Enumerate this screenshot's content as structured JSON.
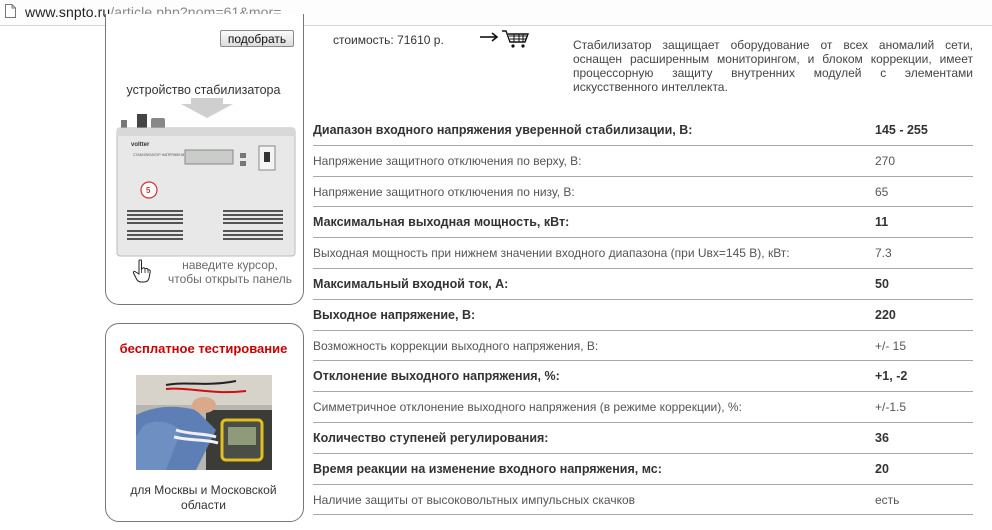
{
  "address_bar": {
    "domain": "www.snpto.ru",
    "path": "/article.php?nom=61&mor="
  },
  "left": {
    "pick_button": "подобрать",
    "device_label": "устройство стабилизатора",
    "device_brand": "voltter",
    "device_caption": "СТАБИЛИЗАТОР НАПРЯЖЕНИЯ",
    "hint_line1": "наведите курсор,",
    "hint_line2": "чтобы открыть панель",
    "free_testing": "бесплатное тестирование",
    "region_line1": "для Москвы и Московской",
    "region_line2": "области"
  },
  "product": {
    "cost": "стоимость: 71610 р.",
    "description": "Стабилизатор защищает оборудование от всех аномалий сети, оснащен расширенным мониторингом, и блоком коррекции, имеет процессорную защиту внутренних модулей с элементами искусственного интеллекта."
  },
  "specs": [
    {
      "label": "Диапазон входного напряжения уверенной стабилизации, В:",
      "value": "145 - 255",
      "bold": true
    },
    {
      "label": "Напряжение защитного отключения по верху, В:",
      "value": "270",
      "bold": false
    },
    {
      "label": "Напряжение защитного отключения по низу, В:",
      "value": "65",
      "bold": false
    },
    {
      "label": "Максимальная выходная мощность, кВт:",
      "value": "11",
      "bold": true
    },
    {
      "label": "Выходная мощность при нижнем значении входного диапазона (при Uвх=145 В), кВт:",
      "value": "7.3",
      "bold": false
    },
    {
      "label": "Максимальный входной ток, А:",
      "value": "50",
      "bold": true
    },
    {
      "label": "Выходное напряжение, В:",
      "value": "220",
      "bold": true
    },
    {
      "label": "Возможность коррекции выходного напряжения, В:",
      "value": "+/- 15",
      "bold": false
    },
    {
      "label": "Отклонение выходного напряжения, %:",
      "value": "+1, -2",
      "bold": true
    },
    {
      "label": "Симметричное отклонение выходного напряжения (в режиме коррекции), %:",
      "value": "+/-1.5",
      "bold": false
    },
    {
      "label": "Количество ступеней регулирования:",
      "value": "36",
      "bold": true
    },
    {
      "label": "Время реакции на изменение входного напряжения, мс:",
      "value": "20",
      "bold": true
    },
    {
      "label": "Наличие защиты от высоковольтных импульсных скачков",
      "value": "есть",
      "bold": false
    }
  ],
  "colors": {
    "accent_red": "#cc0000",
    "border": "#777777",
    "row_line": "#a9a9a9"
  }
}
